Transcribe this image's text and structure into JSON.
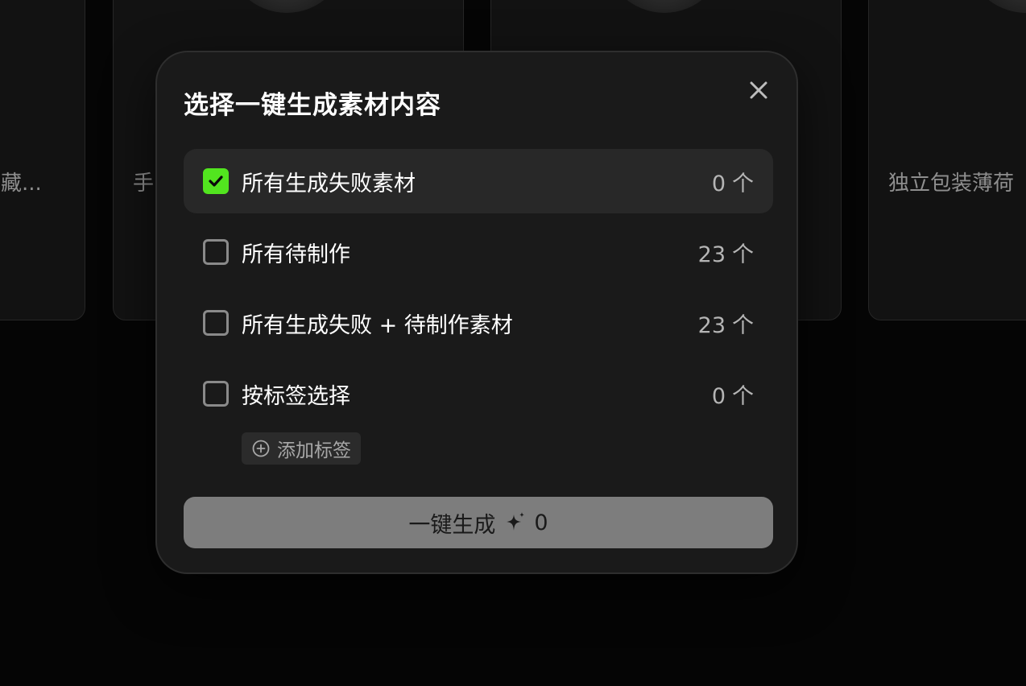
{
  "background": {
    "cards": [
      {
        "title": "藏..."
      },
      {
        "title": "手"
      },
      {
        "title": ""
      },
      {
        "title": "独立包装薄荷"
      }
    ]
  },
  "dialog": {
    "title": "选择一键生成素材内容",
    "close_icon": "close-icon",
    "options": [
      {
        "label": "所有生成失败素材",
        "count": "0",
        "unit": "个",
        "checked": true
      },
      {
        "label": "所有待制作",
        "count": "23",
        "unit": "个",
        "checked": false
      },
      {
        "label": "所有生成失败 + 待制作素材",
        "count": "23",
        "unit": "个",
        "checked": false
      },
      {
        "label": "按标签选择",
        "count": "0",
        "unit": "个",
        "checked": false
      }
    ],
    "add_tag": {
      "icon": "plus-circle-icon",
      "label": "添加标签"
    },
    "generate": {
      "label": "一键生成",
      "icon": "sparkle-icon",
      "count": "0"
    }
  },
  "colors": {
    "accent": "#52e51f",
    "modal_bg": "#1a1a1a",
    "button_bg": "#7d7d7d"
  }
}
